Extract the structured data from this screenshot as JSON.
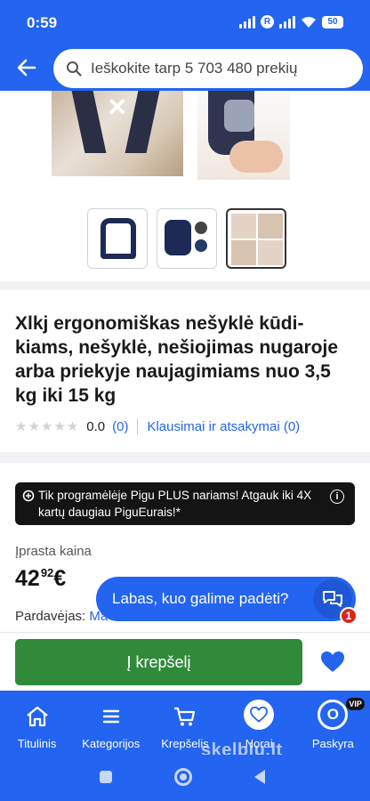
{
  "status": {
    "time": "0:59",
    "battery": "50"
  },
  "search": {
    "placeholder": "Ieškokite tarp 5 703 480 prekių"
  },
  "product": {
    "title": "Xlkj ergonomiškas nešyklė kūdi-kiams, nešyklė, nešiojimas nugaroje arba priekyje naujagimiams nuo 3,5 kg iki 15 kg",
    "rating_value": "0.0",
    "rating_count": "(0)",
    "qa_label": "Klausimai ir atsakymai (0)"
  },
  "promo": {
    "text": "Tik programėlėje Pigu PLUS nariams! Atgauk iki 4X kartų daugiau PiguEurais!*"
  },
  "pricing": {
    "regular_label": "Įprasta kaina",
    "price_int": "42",
    "price_dec": "92",
    "currency": "€",
    "seller_label": "Pardavėjas:",
    "seller_name": "Ma"
  },
  "chat": {
    "label": "Labas, kuo galime padėti?",
    "badge": "1"
  },
  "actions": {
    "cart_label": "Į krepšelį"
  },
  "nav": {
    "items": [
      {
        "label": "Titulinis",
        "icon": "home-icon"
      },
      {
        "label": "Kategorijos",
        "icon": "menu-icon"
      },
      {
        "label": "Krepšelis",
        "icon": "cart-icon"
      },
      {
        "label": "Norai",
        "icon": "heart-icon"
      },
      {
        "label": "Paskyra",
        "icon": "account-icon"
      }
    ],
    "vip_badge": "VIP",
    "account_letter": "O"
  },
  "watermark": "skelbiu.lt",
  "colors": {
    "brand": "#2364f0",
    "cart_green": "#2f8a3a",
    "badge_red": "#d9261c"
  }
}
